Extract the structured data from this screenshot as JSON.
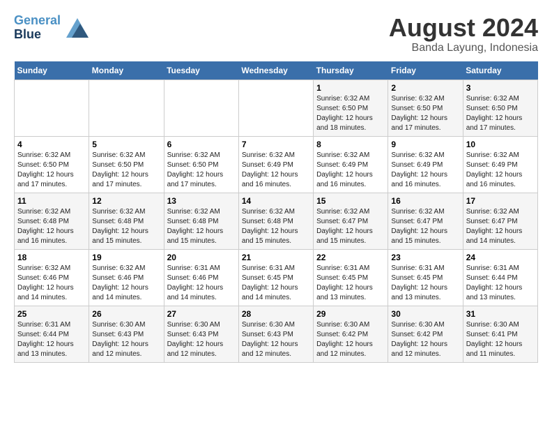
{
  "header": {
    "logo_line1": "General",
    "logo_line2": "Blue",
    "month_year": "August 2024",
    "location": "Banda Layung, Indonesia"
  },
  "days_of_week": [
    "Sunday",
    "Monday",
    "Tuesday",
    "Wednesday",
    "Thursday",
    "Friday",
    "Saturday"
  ],
  "weeks": [
    [
      {
        "day": "",
        "info": ""
      },
      {
        "day": "",
        "info": ""
      },
      {
        "day": "",
        "info": ""
      },
      {
        "day": "",
        "info": ""
      },
      {
        "day": "1",
        "info": "Sunrise: 6:32 AM\nSunset: 6:50 PM\nDaylight: 12 hours\nand 18 minutes."
      },
      {
        "day": "2",
        "info": "Sunrise: 6:32 AM\nSunset: 6:50 PM\nDaylight: 12 hours\nand 17 minutes."
      },
      {
        "day": "3",
        "info": "Sunrise: 6:32 AM\nSunset: 6:50 PM\nDaylight: 12 hours\nand 17 minutes."
      }
    ],
    [
      {
        "day": "4",
        "info": "Sunrise: 6:32 AM\nSunset: 6:50 PM\nDaylight: 12 hours\nand 17 minutes."
      },
      {
        "day": "5",
        "info": "Sunrise: 6:32 AM\nSunset: 6:50 PM\nDaylight: 12 hours\nand 17 minutes."
      },
      {
        "day": "6",
        "info": "Sunrise: 6:32 AM\nSunset: 6:50 PM\nDaylight: 12 hours\nand 17 minutes."
      },
      {
        "day": "7",
        "info": "Sunrise: 6:32 AM\nSunset: 6:49 PM\nDaylight: 12 hours\nand 16 minutes."
      },
      {
        "day": "8",
        "info": "Sunrise: 6:32 AM\nSunset: 6:49 PM\nDaylight: 12 hours\nand 16 minutes."
      },
      {
        "day": "9",
        "info": "Sunrise: 6:32 AM\nSunset: 6:49 PM\nDaylight: 12 hours\nand 16 minutes."
      },
      {
        "day": "10",
        "info": "Sunrise: 6:32 AM\nSunset: 6:49 PM\nDaylight: 12 hours\nand 16 minutes."
      }
    ],
    [
      {
        "day": "11",
        "info": "Sunrise: 6:32 AM\nSunset: 6:48 PM\nDaylight: 12 hours\nand 16 minutes."
      },
      {
        "day": "12",
        "info": "Sunrise: 6:32 AM\nSunset: 6:48 PM\nDaylight: 12 hours\nand 15 minutes."
      },
      {
        "day": "13",
        "info": "Sunrise: 6:32 AM\nSunset: 6:48 PM\nDaylight: 12 hours\nand 15 minutes."
      },
      {
        "day": "14",
        "info": "Sunrise: 6:32 AM\nSunset: 6:48 PM\nDaylight: 12 hours\nand 15 minutes."
      },
      {
        "day": "15",
        "info": "Sunrise: 6:32 AM\nSunset: 6:47 PM\nDaylight: 12 hours\nand 15 minutes."
      },
      {
        "day": "16",
        "info": "Sunrise: 6:32 AM\nSunset: 6:47 PM\nDaylight: 12 hours\nand 15 minutes."
      },
      {
        "day": "17",
        "info": "Sunrise: 6:32 AM\nSunset: 6:47 PM\nDaylight: 12 hours\nand 14 minutes."
      }
    ],
    [
      {
        "day": "18",
        "info": "Sunrise: 6:32 AM\nSunset: 6:46 PM\nDaylight: 12 hours\nand 14 minutes."
      },
      {
        "day": "19",
        "info": "Sunrise: 6:32 AM\nSunset: 6:46 PM\nDaylight: 12 hours\nand 14 minutes."
      },
      {
        "day": "20",
        "info": "Sunrise: 6:31 AM\nSunset: 6:46 PM\nDaylight: 12 hours\nand 14 minutes."
      },
      {
        "day": "21",
        "info": "Sunrise: 6:31 AM\nSunset: 6:45 PM\nDaylight: 12 hours\nand 14 minutes."
      },
      {
        "day": "22",
        "info": "Sunrise: 6:31 AM\nSunset: 6:45 PM\nDaylight: 12 hours\nand 13 minutes."
      },
      {
        "day": "23",
        "info": "Sunrise: 6:31 AM\nSunset: 6:45 PM\nDaylight: 12 hours\nand 13 minutes."
      },
      {
        "day": "24",
        "info": "Sunrise: 6:31 AM\nSunset: 6:44 PM\nDaylight: 12 hours\nand 13 minutes."
      }
    ],
    [
      {
        "day": "25",
        "info": "Sunrise: 6:31 AM\nSunset: 6:44 PM\nDaylight: 12 hours\nand 13 minutes."
      },
      {
        "day": "26",
        "info": "Sunrise: 6:30 AM\nSunset: 6:43 PM\nDaylight: 12 hours\nand 12 minutes."
      },
      {
        "day": "27",
        "info": "Sunrise: 6:30 AM\nSunset: 6:43 PM\nDaylight: 12 hours\nand 12 minutes."
      },
      {
        "day": "28",
        "info": "Sunrise: 6:30 AM\nSunset: 6:43 PM\nDaylight: 12 hours\nand 12 minutes."
      },
      {
        "day": "29",
        "info": "Sunrise: 6:30 AM\nSunset: 6:42 PM\nDaylight: 12 hours\nand 12 minutes."
      },
      {
        "day": "30",
        "info": "Sunrise: 6:30 AM\nSunset: 6:42 PM\nDaylight: 12 hours\nand 12 minutes."
      },
      {
        "day": "31",
        "info": "Sunrise: 6:30 AM\nSunset: 6:41 PM\nDaylight: 12 hours\nand 11 minutes."
      }
    ]
  ]
}
